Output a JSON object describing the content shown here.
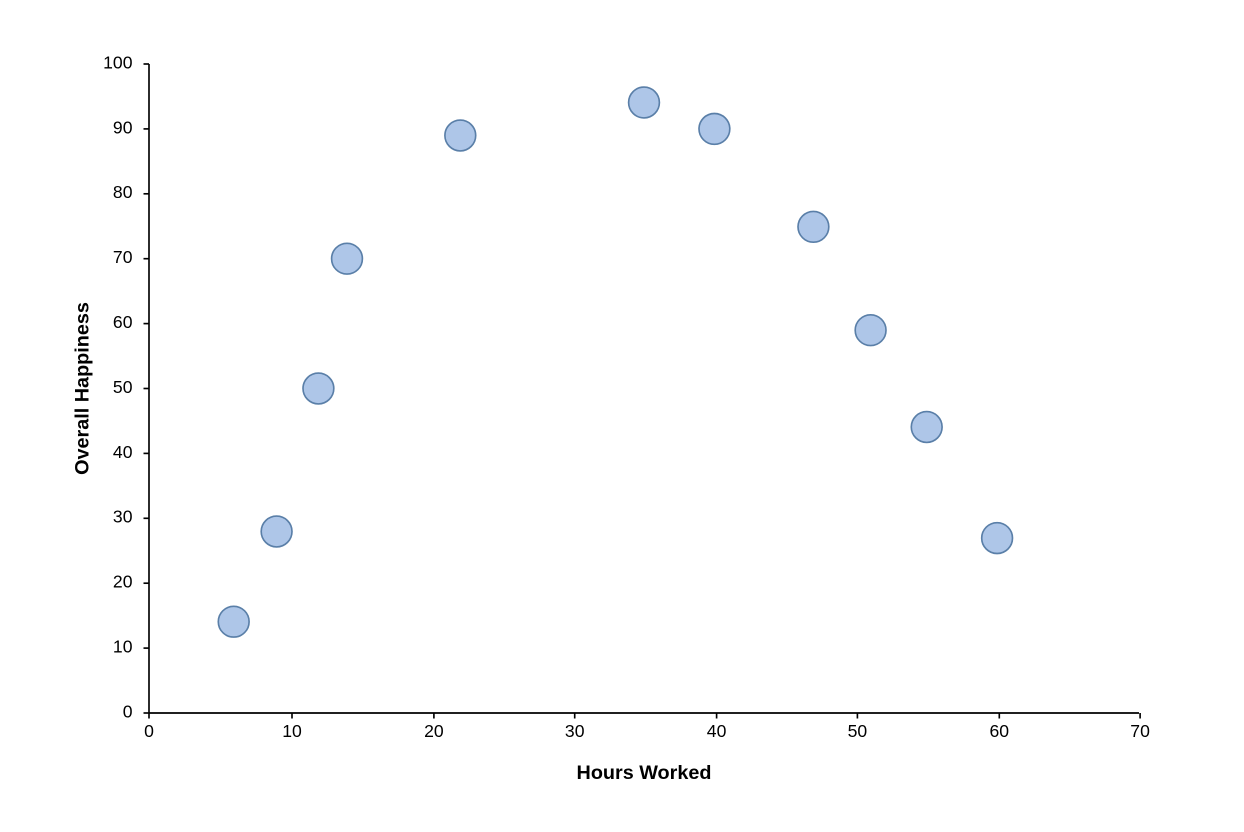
{
  "chart": {
    "title": "",
    "x_axis_label": "Hours Worked",
    "y_axis_label": "Overall Happiness",
    "x_min": 0,
    "x_max": 70,
    "y_min": 0,
    "y_max": 100,
    "x_ticks": [
      0,
      10,
      20,
      30,
      40,
      50,
      60,
      70
    ],
    "y_ticks": [
      0,
      10,
      20,
      30,
      40,
      50,
      60,
      70,
      80,
      90,
      100
    ],
    "data_points": [
      {
        "x": 6,
        "y": 14
      },
      {
        "x": 9,
        "y": 28
      },
      {
        "x": 12,
        "y": 50
      },
      {
        "x": 14,
        "y": 70
      },
      {
        "x": 22,
        "y": 89
      },
      {
        "x": 35,
        "y": 94
      },
      {
        "x": 40,
        "y": 90
      },
      {
        "x": 47,
        "y": 75
      },
      {
        "x": 51,
        "y": 59
      },
      {
        "x": 55,
        "y": 44
      },
      {
        "x": 60,
        "y": 27
      }
    ],
    "dot_fill": "#aec6e8",
    "dot_stroke": "#5a7fa8",
    "dot_radius": 14
  }
}
